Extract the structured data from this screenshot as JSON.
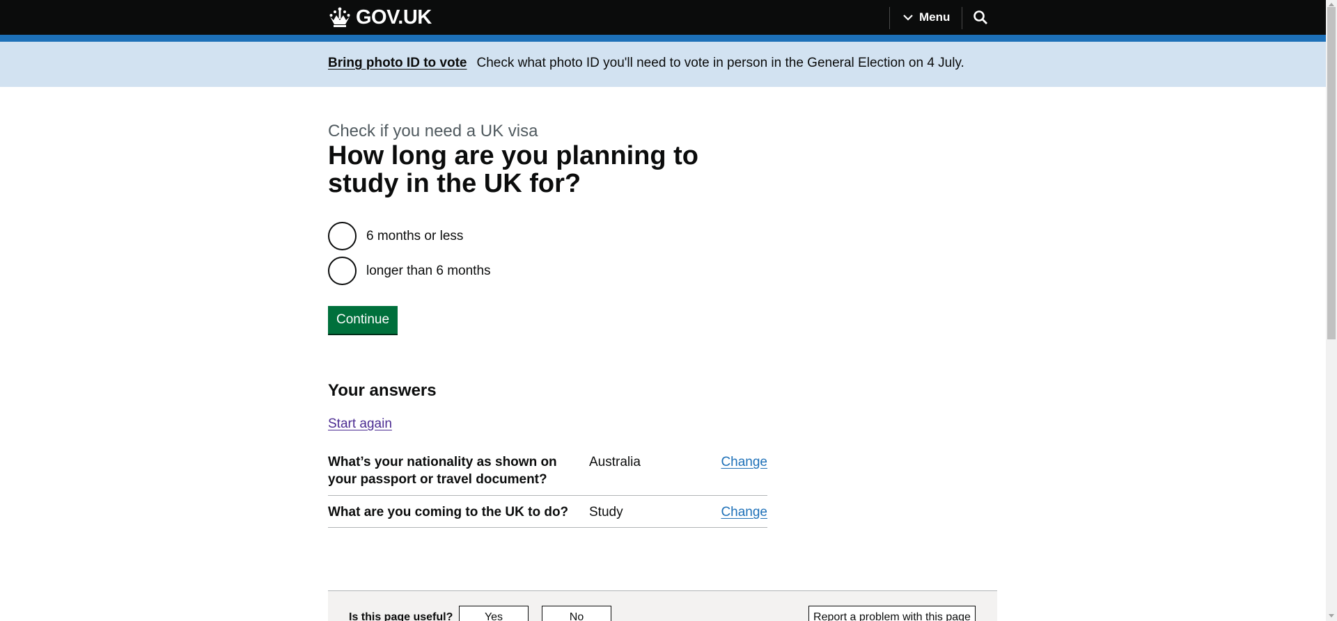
{
  "header": {
    "logo_text": "GOV.UK",
    "menu_label": "Menu"
  },
  "banner": {
    "link": "Bring photo ID to vote",
    "text": "Check what photo ID you'll need to vote in person in the General Election on 4 July."
  },
  "main": {
    "caption": "Check if you need a UK visa",
    "question": "How long are you planning to study in the UK for?",
    "options": [
      {
        "label": "6 months or less"
      },
      {
        "label": "longer than 6 months"
      }
    ],
    "continue_label": "Continue"
  },
  "answers": {
    "heading": "Your answers",
    "start_again": "Start again",
    "rows": [
      {
        "question": "What’s your nationality as shown on your passport or travel document?",
        "value": "Australia",
        "action": "Change"
      },
      {
        "question": "What are you coming to the UK to do?",
        "value": "Study",
        "action": "Change"
      }
    ]
  },
  "feedback": {
    "question": "Is this page useful?",
    "yes": "Yes",
    "no": "No",
    "report": "Report a problem with this page"
  },
  "colors": {
    "header_bg": "#0b0c0c",
    "brand_blue": "#1d70b8",
    "banner_bg": "#d2e2f1",
    "button_green": "#00703c",
    "visited_link": "#4c2c92"
  }
}
